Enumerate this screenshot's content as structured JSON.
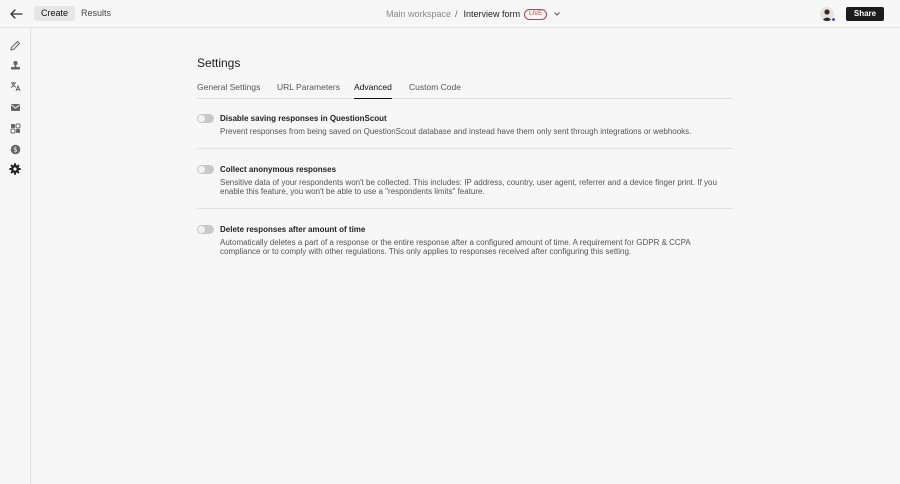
{
  "topbar": {
    "tabs": [
      {
        "label": "Create",
        "active": true
      },
      {
        "label": "Results",
        "active": false
      }
    ],
    "breadcrumb": {
      "workspace": "Main workspace",
      "separator": "/",
      "form": "Interview form",
      "status_badge": "LIVE"
    },
    "share_label": "Share"
  },
  "sidebar": {
    "icons": [
      "pencil-icon",
      "stamp-icon",
      "translate-icon",
      "mail-icon",
      "integrations-icon",
      "dollar-icon",
      "gear-icon"
    ],
    "active_icon": "gear-icon"
  },
  "settings": {
    "title": "Settings",
    "tabs": [
      {
        "label": "General Settings",
        "active": false
      },
      {
        "label": "URL Parameters",
        "active": false
      },
      {
        "label": "Advanced",
        "active": true
      },
      {
        "label": "Custom Code",
        "active": false
      }
    ],
    "items": [
      {
        "title": "Disable saving responses in QuestionScout",
        "description": "Prevent responses from being saved on QuestionScout database and instead have them only sent through integrations or webhooks.",
        "enabled": false
      },
      {
        "title": "Collect anonymous responses",
        "description": "Sensitive data of your respondents won't be collected. This includes: IP address, country, user agent, referrer and a device finger print. If you enable this feature, you won't be able to use a \"respondents limits\" feature.",
        "enabled": false
      },
      {
        "title": "Delete responses after amount of time",
        "description": "Automatically deletes a part of a response or the entire response after a configured amount of time. A requirement for GDPR & CCPA compliance or to comply with other regulations. This only applies to responses received after configuring this setting.",
        "enabled": false
      }
    ]
  },
  "colors": {
    "live": "#d23b3b",
    "share_bg": "#1c1c1c",
    "avatar_status": "#3b55d6"
  }
}
